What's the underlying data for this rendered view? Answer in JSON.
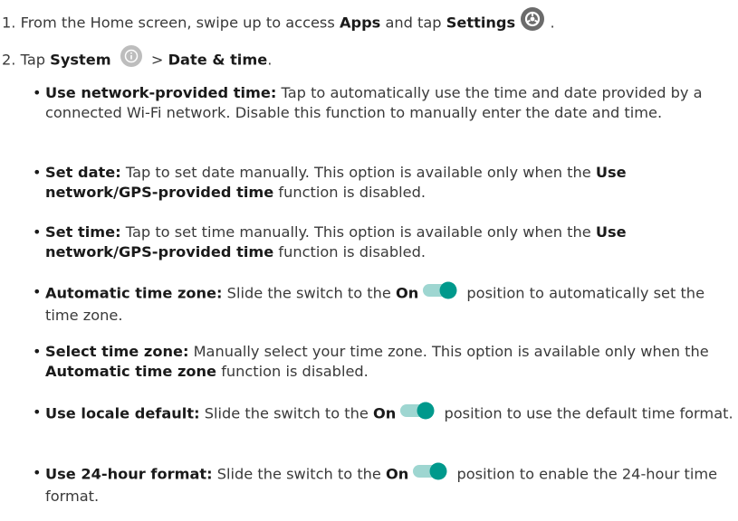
{
  "step1": {
    "number": "1.",
    "text_before": "From the Home screen, swipe up to access ",
    "apps": "Apps",
    "text_mid": " and tap ",
    "settings": "Settings",
    "text_after": " ."
  },
  "step2": {
    "number": "2.",
    "text_before": "Tap ",
    "system": "System",
    "separator": " > ",
    "date_time": "Date & time",
    "text_after": "."
  },
  "bullets": [
    {
      "term": "Use network-provided time:",
      "text": "Tap to automatically use the time and date provided by a connected Wi-Fi network. Disable this function to manually enter the date and time."
    },
    {
      "term": "Set date:",
      "text": "Tap to set date manually. This option is available only when the ",
      "bold2": "Use network/GPS-provided time",
      "text2": " function is disabled."
    },
    {
      "term": "Set time:",
      "text": "Tap to set time manually. This option is available only when the ",
      "bold2": "Use network/GPS-provided time",
      "text2": " function is disabled."
    },
    {
      "term": "Automatic time zone:",
      "text": "Slide the switch to the ",
      "on": "On",
      "text2": " position to automatically set the time zone."
    },
    {
      "term": "Select time zone:",
      "text": "Manually select your time zone. This option is available only when the ",
      "bold2": "Automatic time zone",
      "text2": " function is disabled."
    },
    {
      "term": "Use locale default:",
      "text": "Slide the switch to the ",
      "on": "On",
      "text2": " position to use the default time format."
    },
    {
      "term": "Use 24-hour format:",
      "text": "Slide the switch to the ",
      "on": "On",
      "text2": " position to enable the 24-hour time format."
    }
  ],
  "colors": {
    "toggle_track": "#9ed6d1",
    "toggle_thumb": "#00998c",
    "settings_icon": "#6b6b6b",
    "system_icon": "#bdbdbd"
  },
  "icons": {
    "settings": "settings-gear-icon",
    "system": "info-icon",
    "toggle": "toggle-on-icon"
  }
}
